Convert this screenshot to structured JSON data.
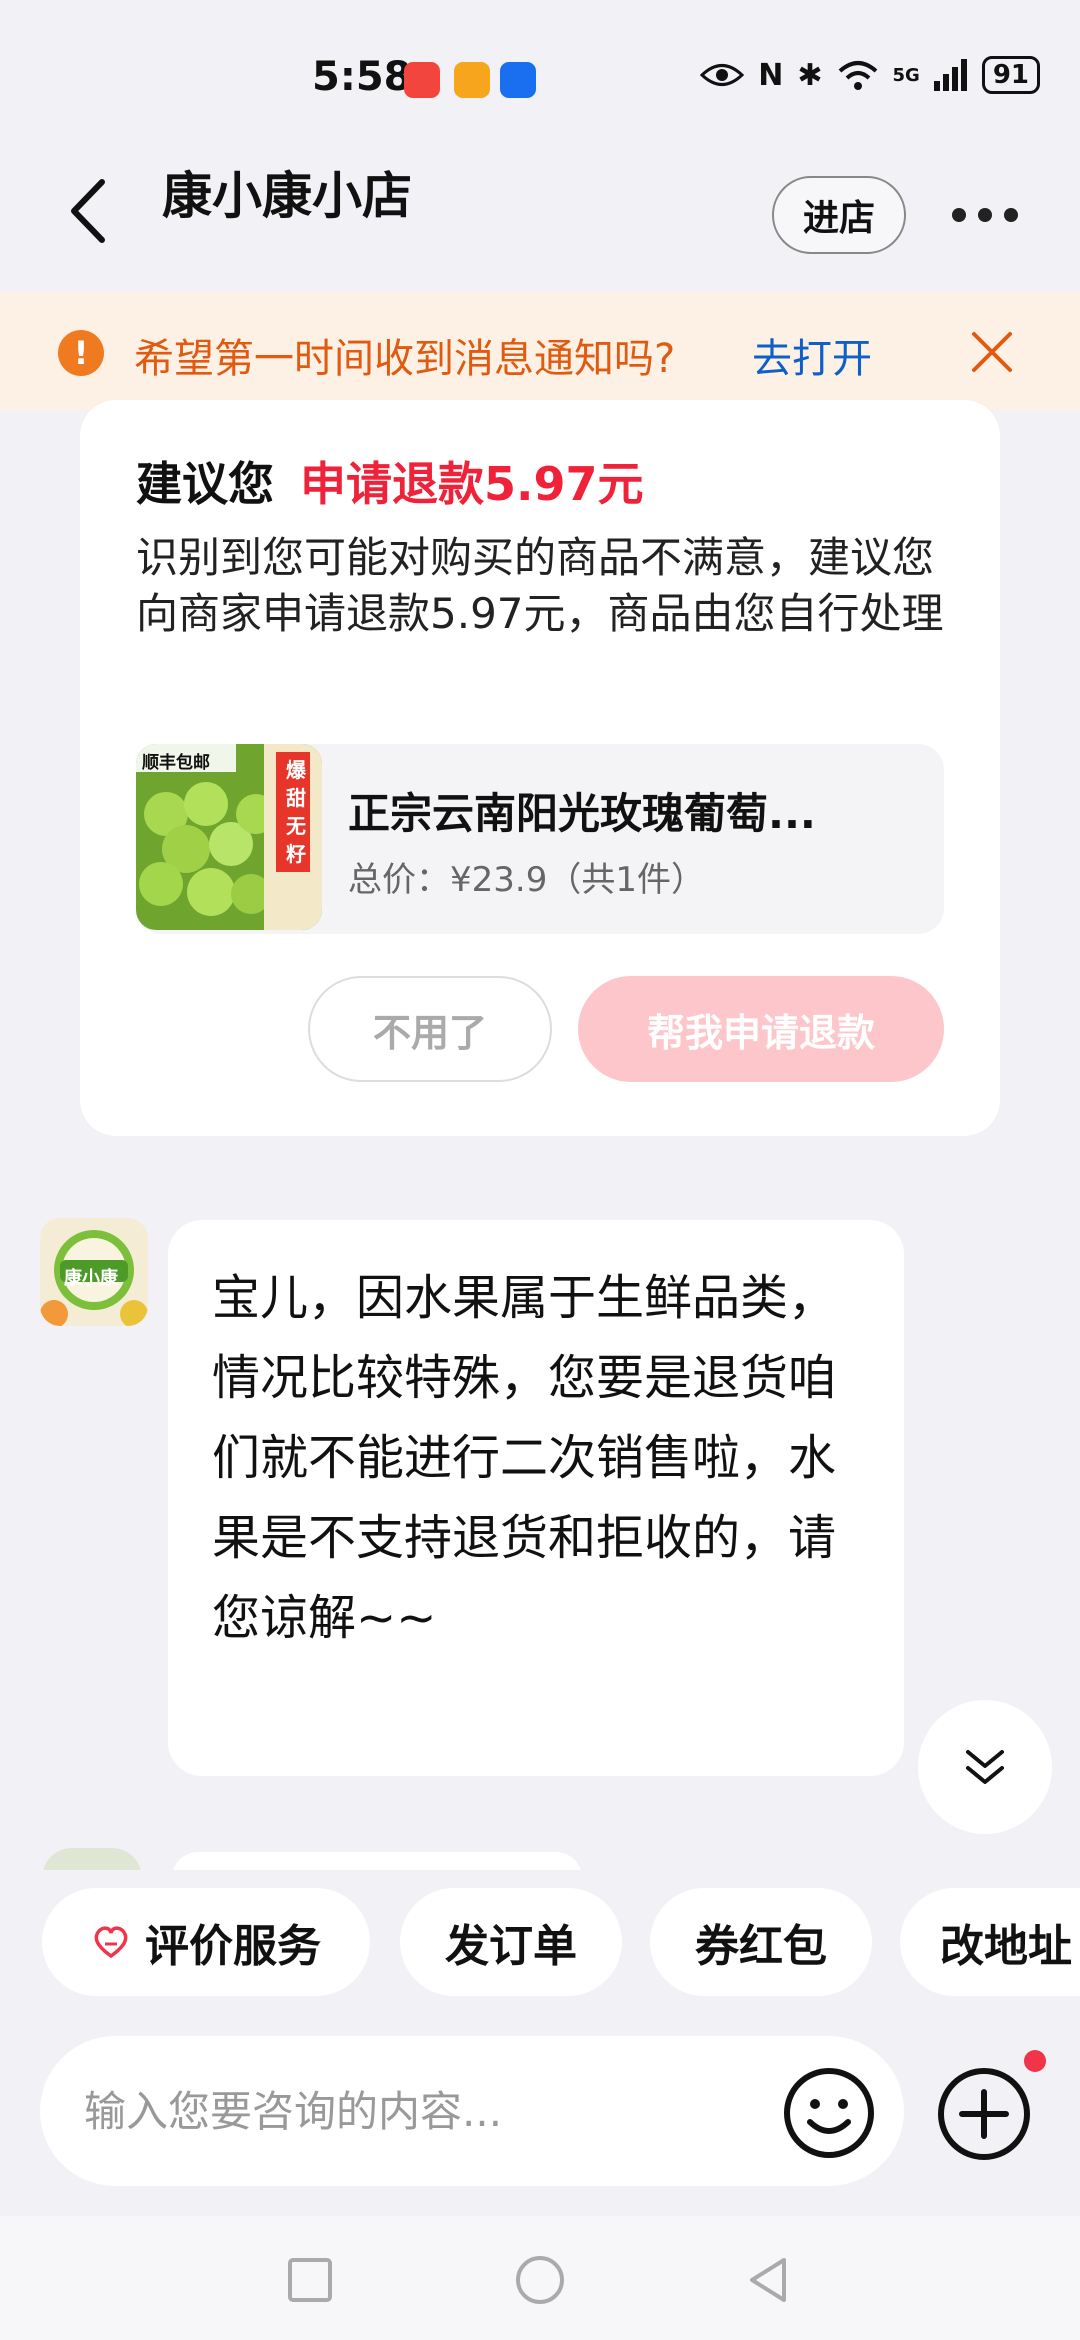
{
  "status_bar": {
    "time": "5:58",
    "network": "5G",
    "battery": "91"
  },
  "header": {
    "title": "康小康小店",
    "enter_label": "进店"
  },
  "notice": {
    "text": "希望第一时间收到消息通知吗?",
    "link": "去打开"
  },
  "refund_card": {
    "title_prefix": "建议您",
    "title_highlight": "申请退款5.97元",
    "description": "识别到您可能对购买的商品不满意，建议您向商家申请退款5.97元，商品由您自行处理",
    "product": {
      "name": "正宗云南阳光玫瑰葡萄...",
      "price": "总价：¥23.9（共1件）",
      "image_badge": "顺丰包邮",
      "image_text": "爆甜无籽"
    },
    "decline_label": "不用了",
    "refund_label": "帮我申请退款"
  },
  "message": {
    "avatar_text": "康小康",
    "text": "宝儿，因水果属于生鲜品类，情况比较特殊，您要是退货咱们就不能进行二次销售啦，水果是不支持退货和拒收的，请您谅解~~"
  },
  "quick_actions": [
    {
      "label": "评价服务",
      "icon": "heart-icon"
    },
    {
      "label": "发订单"
    },
    {
      "label": "券红包"
    },
    {
      "label": "改地址"
    }
  ],
  "input": {
    "placeholder": "输入您要咨询的内容..."
  },
  "colors": {
    "accent_red": "#f0223a",
    "notice_orange": "#e05a10",
    "link_blue": "#0f5fc8"
  }
}
